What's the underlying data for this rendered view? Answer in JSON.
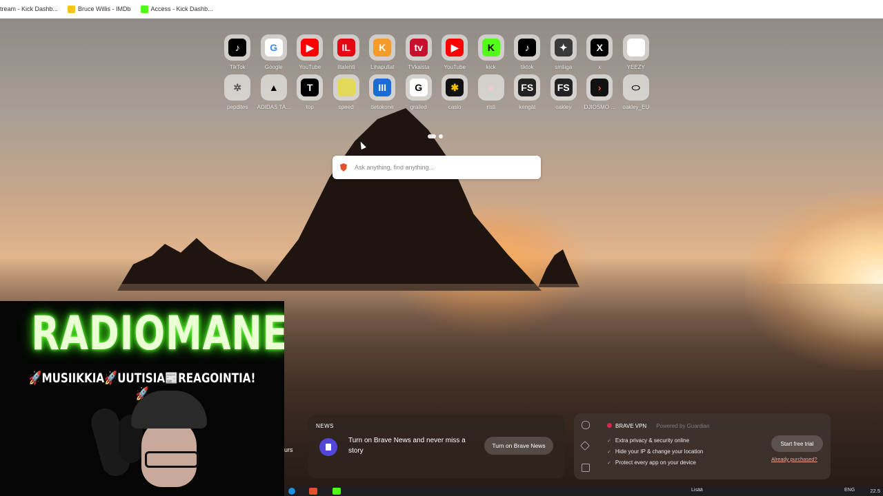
{
  "bookmarks": [
    {
      "label": "tream - Kick Dashb...",
      "color": "#53fc18"
    },
    {
      "label": "Bruce Willis - IMDb",
      "color": "#f5c518"
    },
    {
      "label": "Access - Kick Dashb...",
      "color": "#53fc18"
    }
  ],
  "top_sites": [
    {
      "label": "TikTok",
      "glyph": "♪",
      "bg": "#000000",
      "icon": "tiktok-icon"
    },
    {
      "label": "Google",
      "glyph": "G",
      "bg": "#ffffff",
      "fg": "#4285f4",
      "icon": "google-icon"
    },
    {
      "label": "YouTube",
      "glyph": "▶",
      "bg": "#ff0000",
      "icon": "youtube-icon"
    },
    {
      "label": "Iltalehti",
      "glyph": "IL",
      "bg": "#e30613",
      "icon": "iltalehti-icon"
    },
    {
      "label": "Lihapullat",
      "glyph": "K",
      "bg": "#f59b2a",
      "icon": "k-icon"
    },
    {
      "label": "TVkaista",
      "glyph": "tv",
      "bg": "#c8102e",
      "icon": "tvkaista-icon"
    },
    {
      "label": "YouTube",
      "glyph": "▶",
      "bg": "#ff0000",
      "icon": "youtube-icon"
    },
    {
      "label": "kick",
      "glyph": "K",
      "bg": "#53fc18",
      "fg": "#000000",
      "icon": "kick-icon"
    },
    {
      "label": "tiktok",
      "glyph": "♪",
      "bg": "#000000",
      "icon": "tiktok-icon"
    },
    {
      "label": "smliiga",
      "glyph": "✦",
      "bg": "#3a3a3a",
      "icon": "smliiga-icon"
    },
    {
      "label": "x",
      "glyph": "X",
      "bg": "#000000",
      "icon": "x-icon"
    },
    {
      "label": "YEEZY",
      "glyph": "",
      "bg": "#ffffff",
      "icon": "yeezy-icon"
    },
    {
      "label": "pepdites",
      "glyph": "✲",
      "bg": "transparent",
      "fg": "#555555",
      "icon": "molecule-icon"
    },
    {
      "label": "ADIDAS TA...",
      "glyph": "▲",
      "bg": "transparent",
      "fg": "#000000",
      "icon": "adidas-icon"
    },
    {
      "label": "top",
      "glyph": "T",
      "bg": "#000000",
      "icon": "t-icon"
    },
    {
      "label": "speed",
      "glyph": "",
      "bg": "#e3d95a",
      "icon": "speed-icon"
    },
    {
      "label": "tietokone",
      "glyph": "III",
      "bg": "#1a6dd8",
      "icon": "tietokone-icon"
    },
    {
      "label": "grailed",
      "glyph": "G",
      "bg": "#ffffff",
      "fg": "#000000",
      "icon": "grailed-icon"
    },
    {
      "label": "casio",
      "glyph": "✱",
      "bg": "#111111",
      "fg": "#f2c200",
      "icon": "casio-icon"
    },
    {
      "label": "risti",
      "glyph": "●",
      "bg": "transparent",
      "fg": "#f5c7d1",
      "icon": "risti-icon"
    },
    {
      "label": "kengät",
      "glyph": "FS",
      "bg": "#222222",
      "icon": "fs-icon"
    },
    {
      "label": "oakley",
      "glyph": "FS",
      "bg": "#222222",
      "icon": "fs-icon"
    },
    {
      "label": "DJIOSMO ...",
      "glyph": "›",
      "bg": "#111111",
      "fg": "#f05a28",
      "icon": "djiosmo-icon"
    },
    {
      "label": "oakley_EU",
      "glyph": "⬭",
      "bg": "transparent",
      "fg": "#000000",
      "icon": "oakley-icon"
    }
  ],
  "search": {
    "placeholder": "Ask anything, find anything..."
  },
  "overlay": {
    "title": "RADIOMANE",
    "subtitle": "🚀MUSIIKKIA🚀UUTISIA📰REAGOINTIA!🚀",
    "partial_text": "urs"
  },
  "news": {
    "label": "NEWS",
    "text": "Turn on Brave News and never miss a story",
    "button": "Turn on Brave News"
  },
  "vpn": {
    "title": "BRAVE VPN",
    "powered": "Powered by Guardian",
    "features": [
      "Extra privacy & security online",
      "Hide your IP & change your location",
      "Protect every app on your device"
    ],
    "button": "Start free trial",
    "link": "Already purchased?"
  },
  "taskbar": {
    "time": "22.5",
    "lang": "ENG",
    "misc": "Lisää"
  }
}
